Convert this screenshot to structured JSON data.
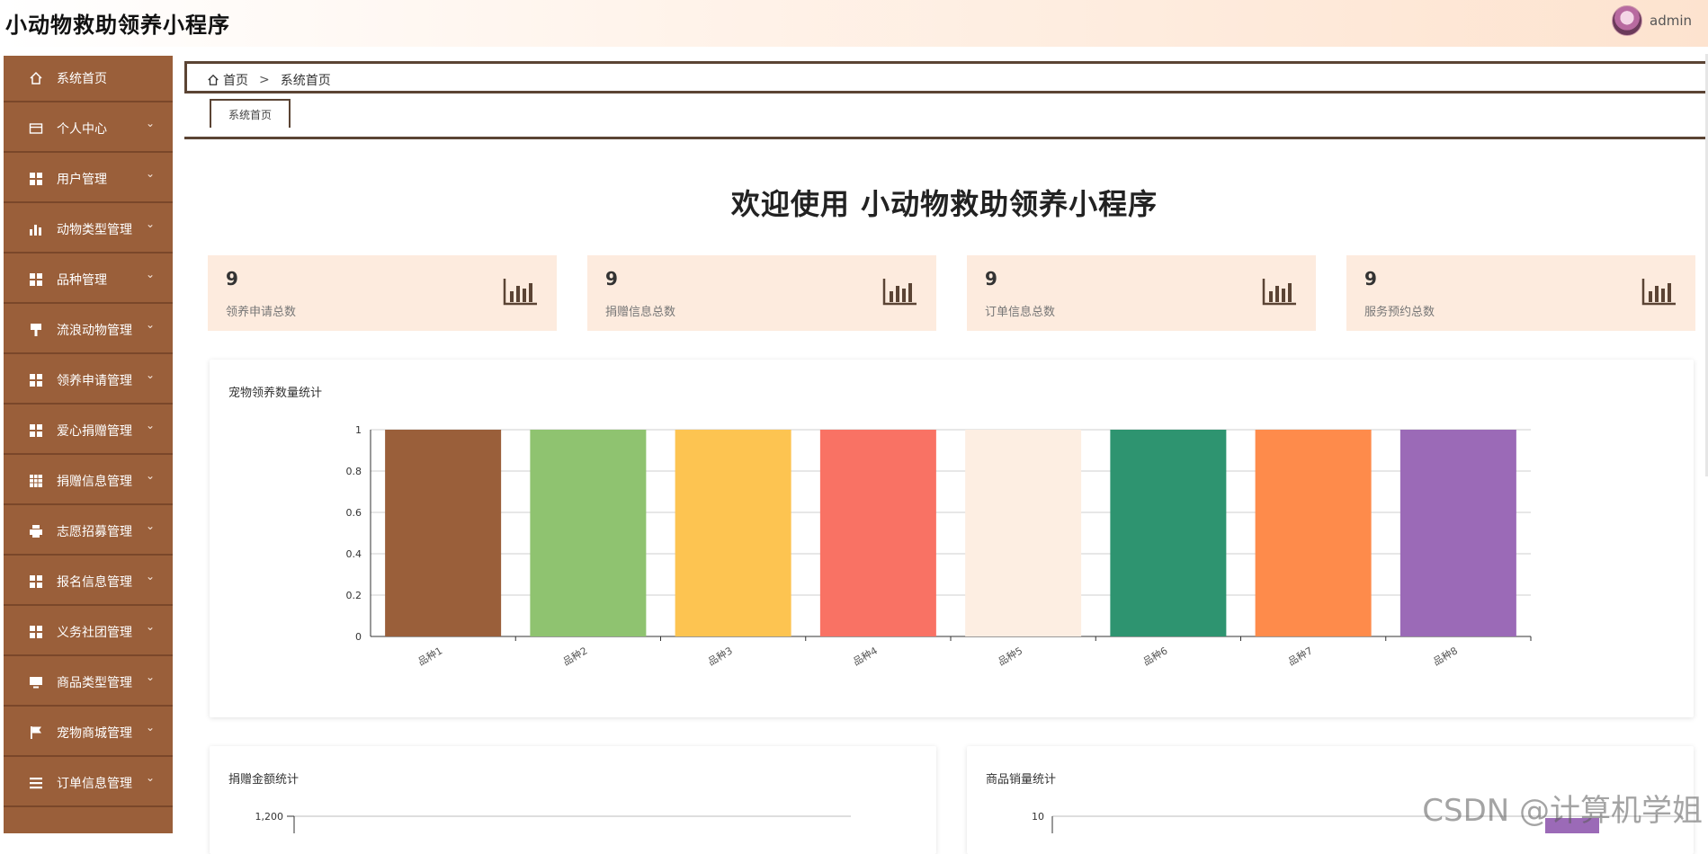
{
  "app": {
    "title": "小动物救助领养小程序"
  },
  "user": {
    "name": "admin"
  },
  "sidebar": {
    "items": [
      {
        "label": "系统首页",
        "icon": "home-icon",
        "has_children": false
      },
      {
        "label": "个人中心",
        "icon": "card-icon",
        "has_children": true
      },
      {
        "label": "用户管理",
        "icon": "grid-icon",
        "has_children": true
      },
      {
        "label": "动物类型管理",
        "icon": "bar-chart-icon",
        "has_children": true
      },
      {
        "label": "品种管理",
        "icon": "grid-icon",
        "has_children": true
      },
      {
        "label": "流浪动物管理",
        "icon": "brush-icon",
        "has_children": true
      },
      {
        "label": "领养申请管理",
        "icon": "grid-icon",
        "has_children": true
      },
      {
        "label": "爱心捐赠管理",
        "icon": "grid-icon",
        "has_children": true
      },
      {
        "label": "捐赠信息管理",
        "icon": "table-icon",
        "has_children": true
      },
      {
        "label": "志愿招募管理",
        "icon": "printer-icon",
        "has_children": true
      },
      {
        "label": "报名信息管理",
        "icon": "grid-icon",
        "has_children": true
      },
      {
        "label": "义务社团管理",
        "icon": "grid-icon",
        "has_children": true
      },
      {
        "label": "商品类型管理",
        "icon": "monitor-icon",
        "has_children": true
      },
      {
        "label": "宠物商城管理",
        "icon": "flag-icon",
        "has_children": true
      },
      {
        "label": "订单信息管理",
        "icon": "list-icon",
        "has_children": true
      }
    ]
  },
  "breadcrumb": {
    "home": "首页",
    "separator": ">",
    "current": "系统首页"
  },
  "tabs": [
    {
      "label": "系统首页"
    }
  ],
  "welcome": "欢迎使用 小动物救助领养小程序",
  "stats": [
    {
      "value": "9",
      "label": "领养申请总数"
    },
    {
      "value": "9",
      "label": "捐赠信息总数"
    },
    {
      "value": "9",
      "label": "订单信息总数"
    },
    {
      "value": "9",
      "label": "服务预约总数"
    }
  ],
  "panels": {
    "adoption_title": "宠物领养数量统计",
    "donation_title": "捐赠金额统计",
    "sales_title": "商品销量统计"
  },
  "watermark": "CSDN @计算机学姐",
  "colors": {
    "sidebar": "#9a5f3a",
    "accent_dark": "#5b4434",
    "stat_card_bg": "#fdebde"
  },
  "chart_data": [
    {
      "type": "bar",
      "title": "宠物领养数量统计",
      "categories": [
        "品种1",
        "品种2",
        "品种3",
        "品种4",
        "品种5",
        "品种6",
        "品种7",
        "品种8"
      ],
      "values": [
        1,
        1,
        1,
        1,
        1,
        1,
        1,
        1
      ],
      "bar_colors": [
        "#9a5f3a",
        "#8fc370",
        "#fdc451",
        "#f97264",
        "#fdeee2",
        "#2e9470",
        "#fe8b4b",
        "#9b6ab7"
      ],
      "ylim": [
        0,
        1
      ],
      "yticks": [
        "0",
        "0.2",
        "0.4",
        "0.6",
        "0.8",
        "1"
      ],
      "grid": true
    },
    {
      "type": "line",
      "title": "捐赠金额统计",
      "yticks_visible": [
        "1,200"
      ],
      "grid": true
    },
    {
      "type": "bar",
      "title": "商品销量统计",
      "yticks_visible": [
        "10"
      ],
      "bar_colors": [
        "#9b6ab7"
      ],
      "grid": true
    }
  ]
}
